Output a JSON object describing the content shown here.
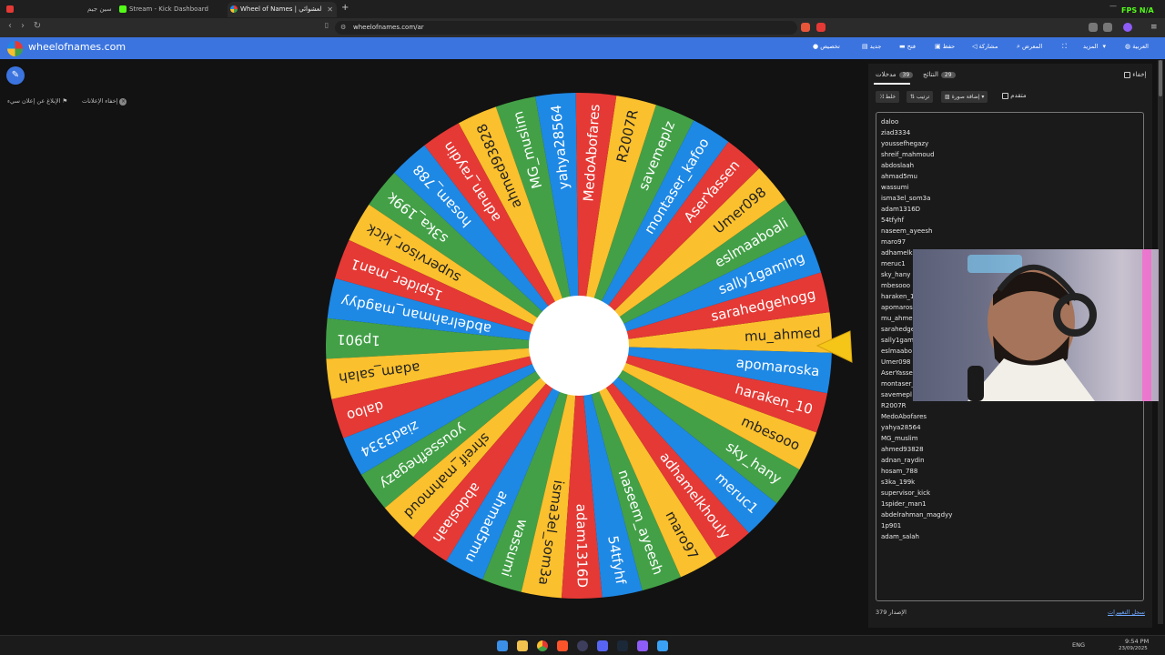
{
  "browser": {
    "tabs": [
      {
        "title": "سين جيم",
        "favicon_color": "#e53935"
      },
      {
        "title": "Stream - Kick Dashboard",
        "favicon_color": "#53fc18"
      },
      {
        "title": "Wheel of Names | اختيار الاسم العشوائي",
        "favicon_color": "#3b74df"
      }
    ],
    "new_tab": "+",
    "minimize": "—",
    "fps_badge": "FPS N/A",
    "url": "wheelofnames.com/ar"
  },
  "appbar": {
    "brand": "wheelofnames.com",
    "menu": [
      {
        "label": "تخصيص",
        "icon": "palette-icon"
      },
      {
        "label": "جديد",
        "icon": "new-file-icon"
      },
      {
        "label": "فتح",
        "icon": "folder-icon"
      },
      {
        "label": "حفظ",
        "icon": "save-icon"
      },
      {
        "label": "مشاركة",
        "icon": "share-icon"
      },
      {
        "label": "المعرض",
        "icon": "search-icon"
      },
      {
        "label": "",
        "icon": "fullscreen-icon"
      },
      {
        "label": "المزيد",
        "icon": "chevron-down-icon"
      },
      {
        "label": "العربية",
        "icon": "globe-icon"
      }
    ]
  },
  "left": {
    "report_ad": "الإبلاغ عن إعلان سيء",
    "hide_ads": "إخفاء الإعلانات"
  },
  "wheel": {
    "colors": [
      "#fbc02d",
      "#e53935",
      "#1e88e5",
      "#43a047"
    ],
    "names": [
      "mu_ahmed",
      "sarahedgehogg",
      "sally1gaming",
      "eslmaaboali",
      "Umer098",
      "AserYassen",
      "montaser_kafoo",
      "savemeplz",
      "R2007R",
      "MedoAbofares",
      "yahya28564",
      "MG_muslim",
      "ahmed93828",
      "adnan_raydin",
      "hosam_788",
      "s3ka_199k",
      "supervisor_kick",
      "1spider_man1",
      "abdelrahman_magdyy",
      "1p901",
      "adam_salah",
      "daloo",
      "ziad3334",
      "youssefhegazy",
      "shreif_mahmoud",
      "abdoslaah",
      "ahmad5mu",
      "wassumi",
      "isma3el_som3a",
      "adam1316D",
      "54tfyhf",
      "naseem_ayeesh",
      "maro97",
      "adhamelkhouly",
      "meruc1",
      "sky_hany",
      "mbesooo",
      "haraken_10",
      "apomaroska"
    ]
  },
  "panel": {
    "tabs": {
      "entries_label": "مدخلات",
      "entries_count": "39",
      "results_label": "النتائج",
      "results_count": "29"
    },
    "hide_label": "إخفاء",
    "tools": {
      "shuffle": "خلط",
      "sort": "ترتيب",
      "add_image": "إضافة صورة",
      "advanced": "متقدم"
    },
    "entries": [
      "daloo",
      "ziad3334",
      "youssefhegazy",
      "shreif_mahmoud",
      "abdoslaah",
      "ahmad5mu",
      "wassumi",
      "isma3el_som3a",
      "adam1316D",
      "54tfyhf",
      "naseem_ayeesh",
      "maro97",
      "adhamelk",
      "meruc1",
      "sky_hany",
      "mbesooo",
      "haraken_1",
      "apomaros",
      "mu_ahme",
      "sarahedge",
      "sally1gam",
      "eslmaabo",
      "Umer098",
      "AserYasse",
      "montaser_",
      "savemepl",
      "R2007R",
      "MedoAbofares",
      "yahya28564",
      "MG_muslim",
      "ahmed93828",
      "adnan_raydin",
      "hosam_788",
      "s3ka_199k",
      "supervisor_kick",
      "1spider_man1",
      "abdelrahman_magdyy",
      "1p901",
      "adam_salah"
    ],
    "version_label": "الإصدار",
    "version": "379",
    "changelog": "سجل التغييرات"
  },
  "taskbar": {
    "lang": "ENG",
    "time": "9:54 PM",
    "date": "23/09/2025"
  }
}
